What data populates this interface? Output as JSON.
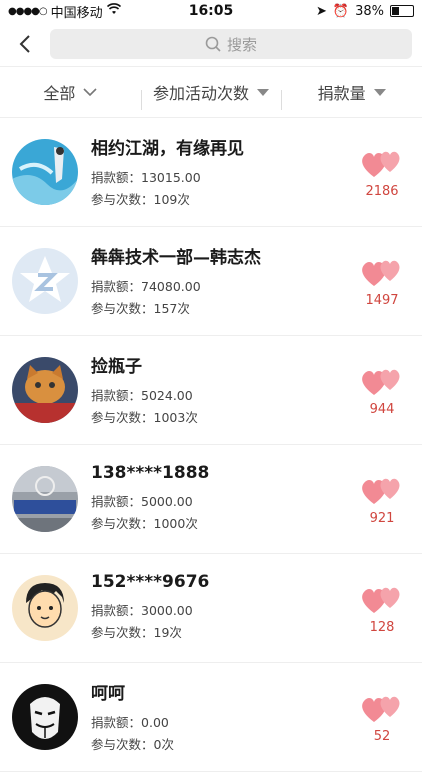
{
  "status": {
    "carrier": "中国移动",
    "time": "16:05",
    "battery": "38%"
  },
  "search": {
    "placeholder": "搜索"
  },
  "filters": [
    {
      "label": "全部"
    },
    {
      "label": "参加活动次数"
    },
    {
      "label": "捐款量"
    }
  ],
  "labels": {
    "donation": "捐款额：",
    "times": "参与次数：",
    "unit": "次"
  },
  "items": [
    {
      "name": "相约江湖，有缘再见",
      "donation": "13015.00",
      "times": "109",
      "likes": "2186",
      "avatar": "water-photo"
    },
    {
      "name": "犇犇技术一部—韩志杰",
      "donation": "74080.00",
      "times": "157",
      "likes": "1497",
      "avatar": "default-z"
    },
    {
      "name": "捡瓶子",
      "donation": "5024.00",
      "times": "1003",
      "likes": "944",
      "avatar": "cat-photo"
    },
    {
      "name": "138****1888",
      "donation": "5000.00",
      "times": "1000",
      "likes": "921",
      "avatar": "car-photo"
    },
    {
      "name": "152****9676",
      "donation": "3000.00",
      "times": "19",
      "likes": "128",
      "avatar": "cartoon-boy"
    },
    {
      "name": "呵呵",
      "donation": "0.00",
      "times": "0",
      "likes": "52",
      "avatar": "mask"
    }
  ],
  "colors": {
    "accent": "#d0463f",
    "heart": "#f28a94"
  }
}
